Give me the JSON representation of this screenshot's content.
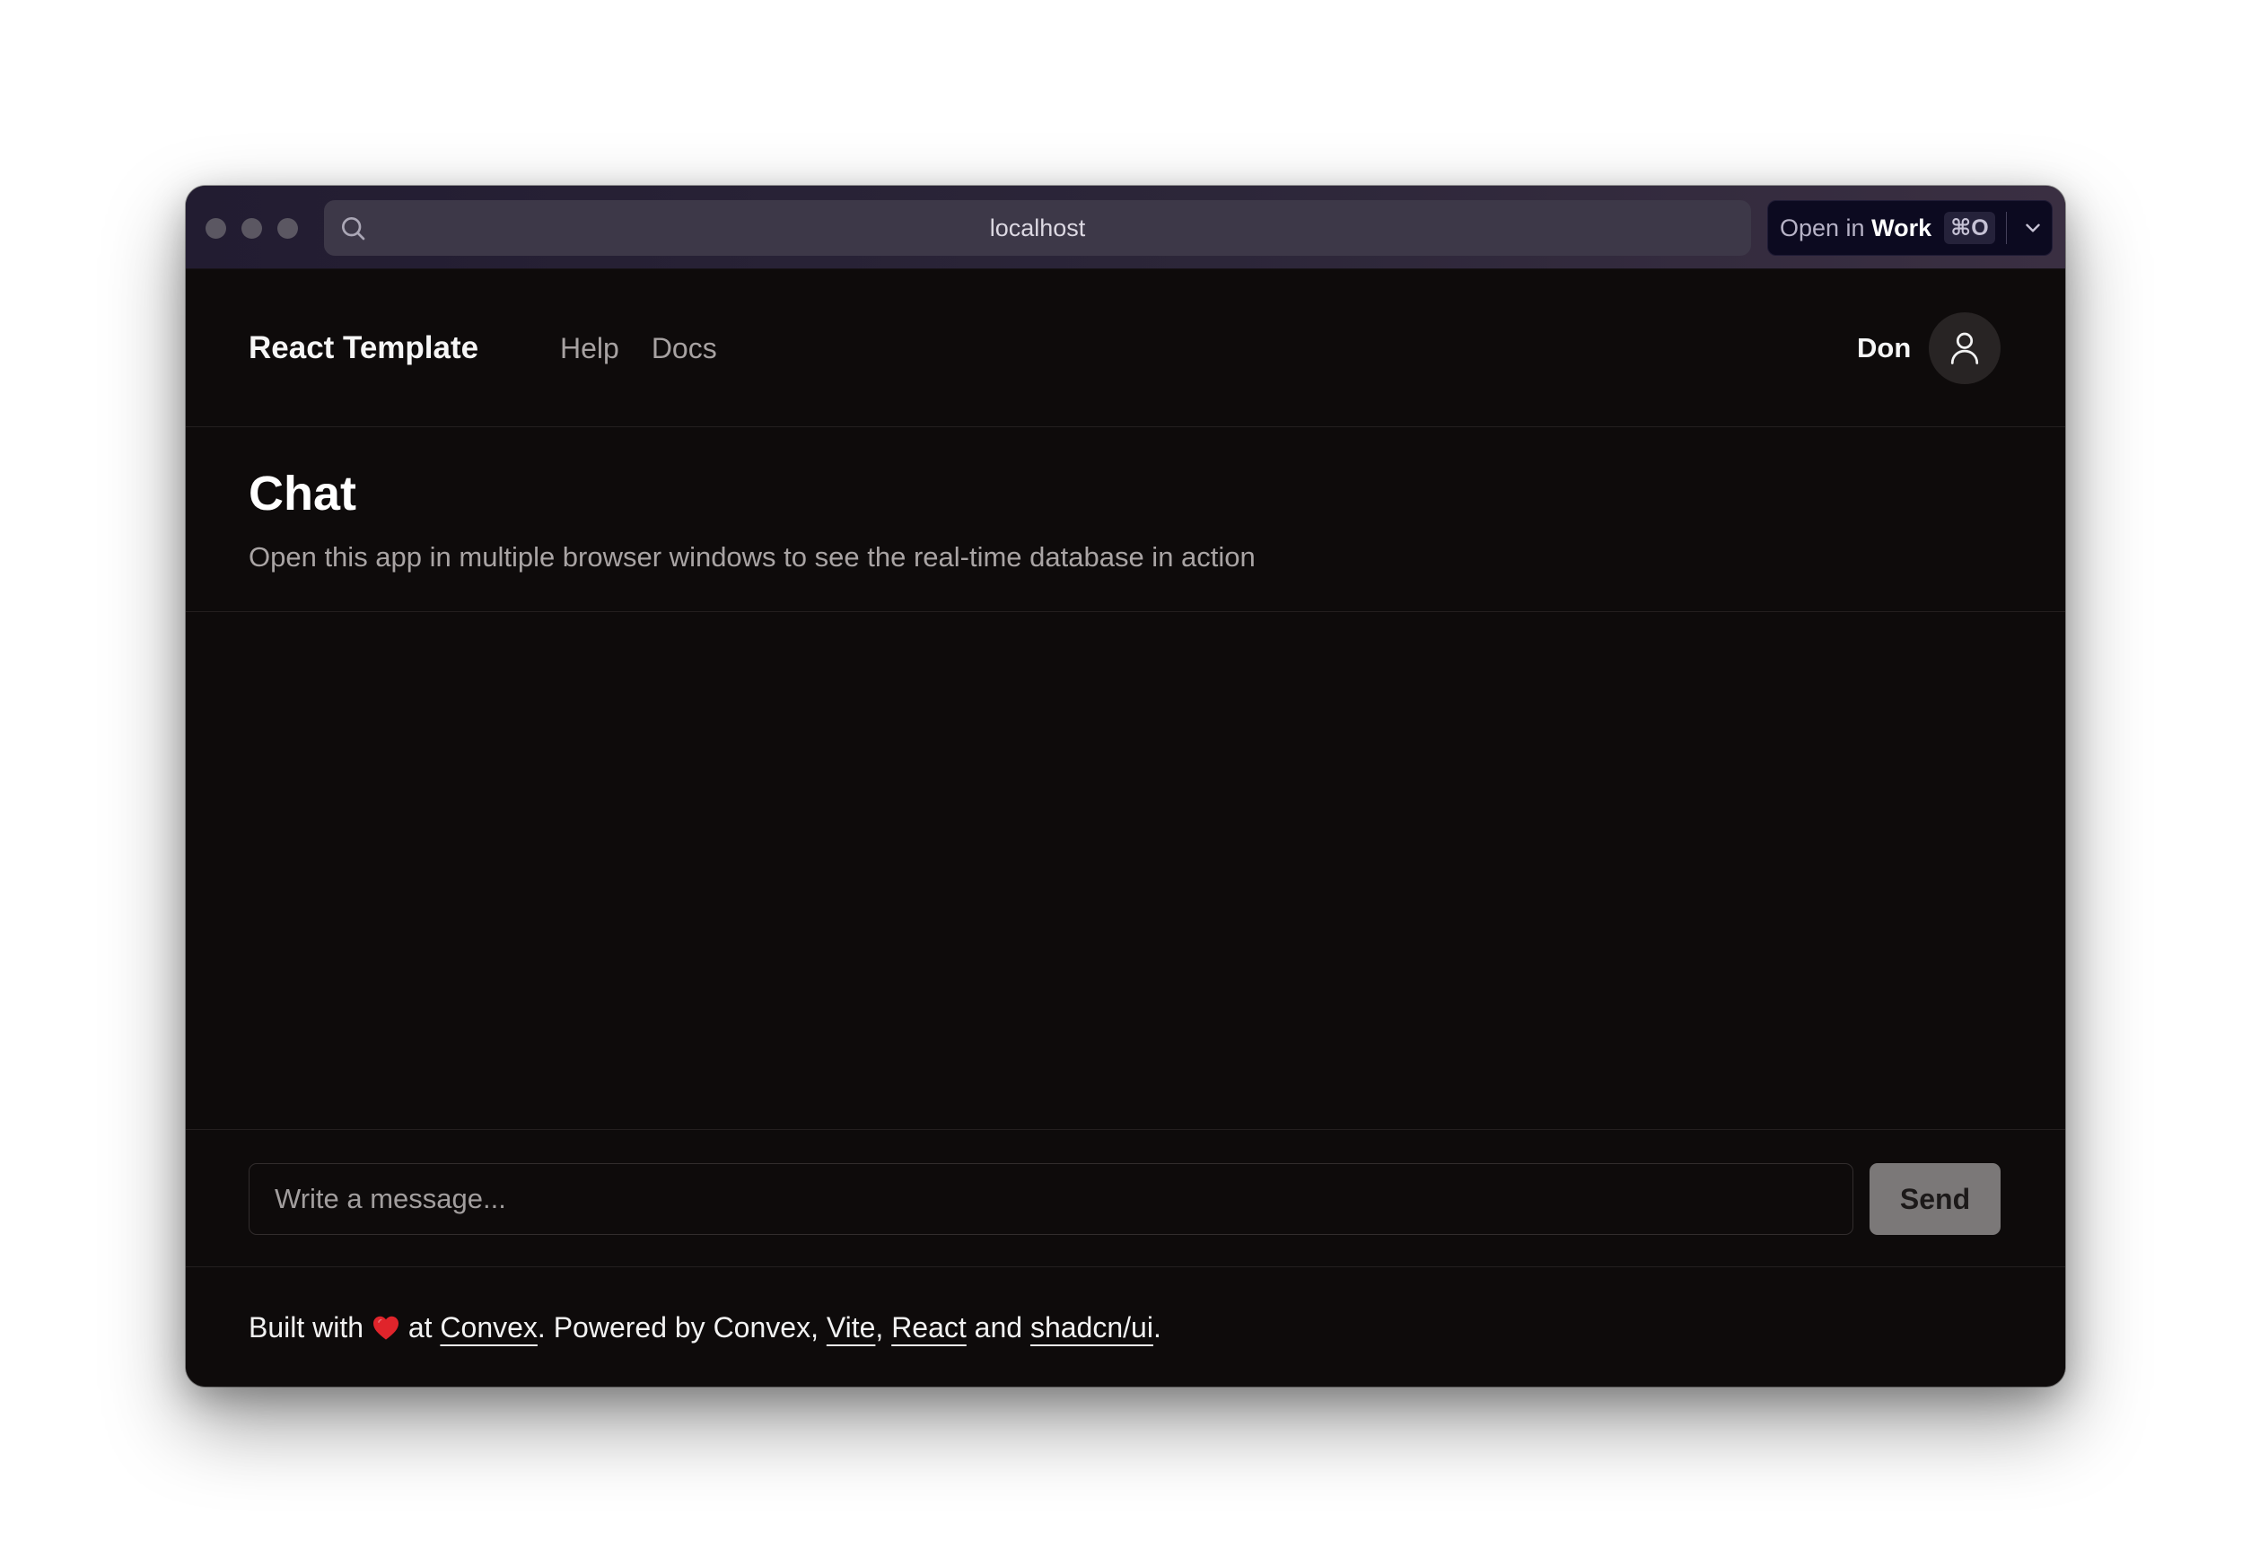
{
  "browser": {
    "url": "localhost",
    "open_in": {
      "prefix": "Open in ",
      "target": "Work",
      "shortcut": "⌘O"
    },
    "icons": [
      "search-icon",
      "extension-icon",
      "link-icon",
      "chevron-down-icon"
    ]
  },
  "nav": {
    "brand": "React Template",
    "links": [
      "Help",
      "Docs"
    ],
    "user_name": "Don",
    "avatar_icon": "user-icon"
  },
  "page": {
    "title": "Chat",
    "subtitle": "Open this app in multiple browser windows to see the real-time database in action"
  },
  "composer": {
    "placeholder": "Write a message...",
    "value": "",
    "send_label": "Send"
  },
  "footer": {
    "built_with": "Built with ",
    "at": " at ",
    "convex_link": "Convex",
    "powered_by": ". Powered by Convex, ",
    "vite_link": "Vite",
    "comma": ", ",
    "react_link": "React",
    "and": " and ",
    "shadcn_link": "shadcn/ui",
    "period": ".",
    "heart_icon": "heart-icon"
  },
  "colors": {
    "app_background": "#0e0b0b",
    "send_button": "#7b7878",
    "heart": "#e0242b"
  }
}
